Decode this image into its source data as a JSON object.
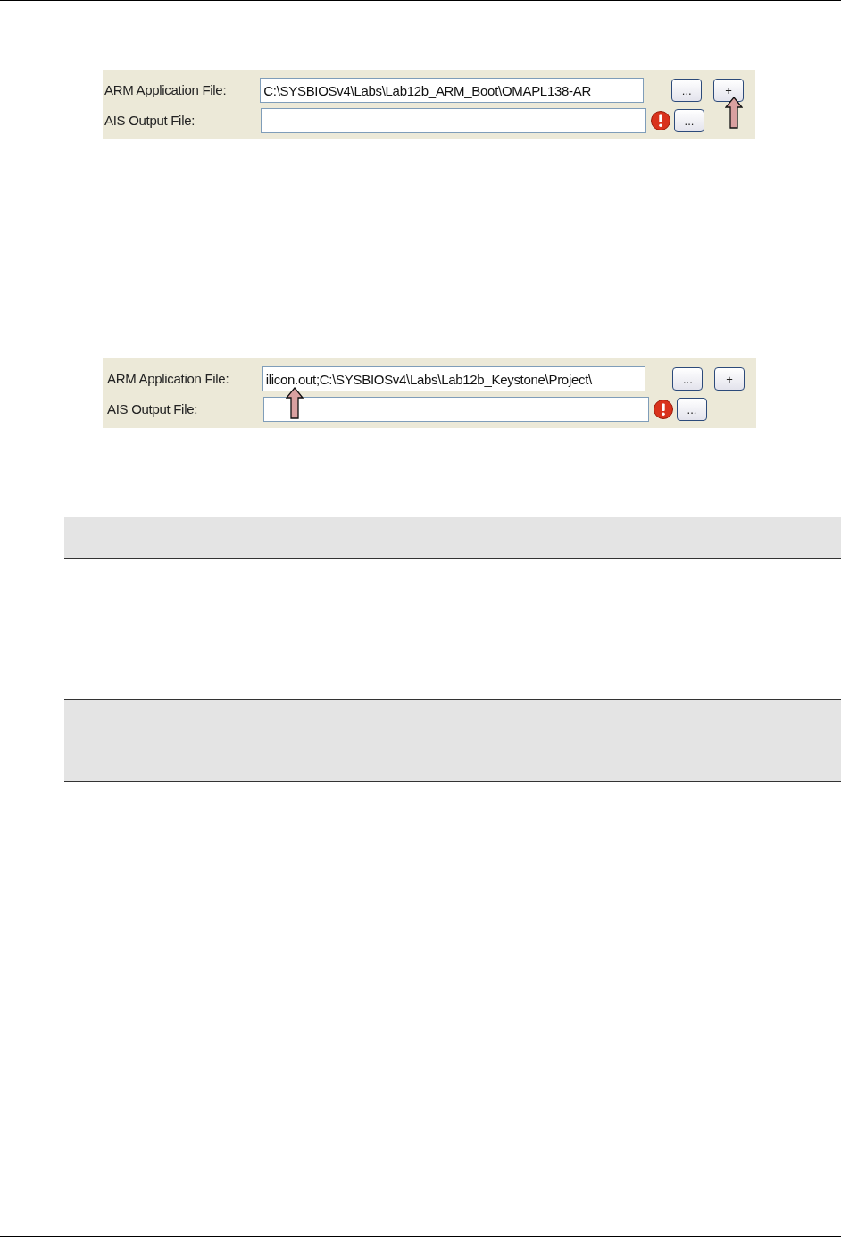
{
  "panels": [
    {
      "arrow": {
        "kind": "add"
      },
      "rows": [
        {
          "label": "ARM Application File:",
          "value": "C:\\SYSBIOSv4\\Labs\\Lab12b_ARM_Boot\\OMAPL138-AR",
          "warning": false,
          "buttons": [
            "...",
            "+"
          ]
        },
        {
          "label": "AIS Output File:",
          "value": "",
          "warning": true,
          "buttons": [
            "..."
          ]
        }
      ]
    },
    {
      "arrow": {
        "kind": "field"
      },
      "rows": [
        {
          "label": "ARM Application File:",
          "value": "ilicon.out;C:\\SYSBIOSv4\\Labs\\Lab12b_Keystone\\Project\\",
          "warning": false,
          "buttons": [
            "...",
            "+"
          ]
        },
        {
          "label": "AIS Output File:",
          "value": "",
          "warning": true,
          "buttons": [
            "..."
          ]
        }
      ]
    }
  ]
}
